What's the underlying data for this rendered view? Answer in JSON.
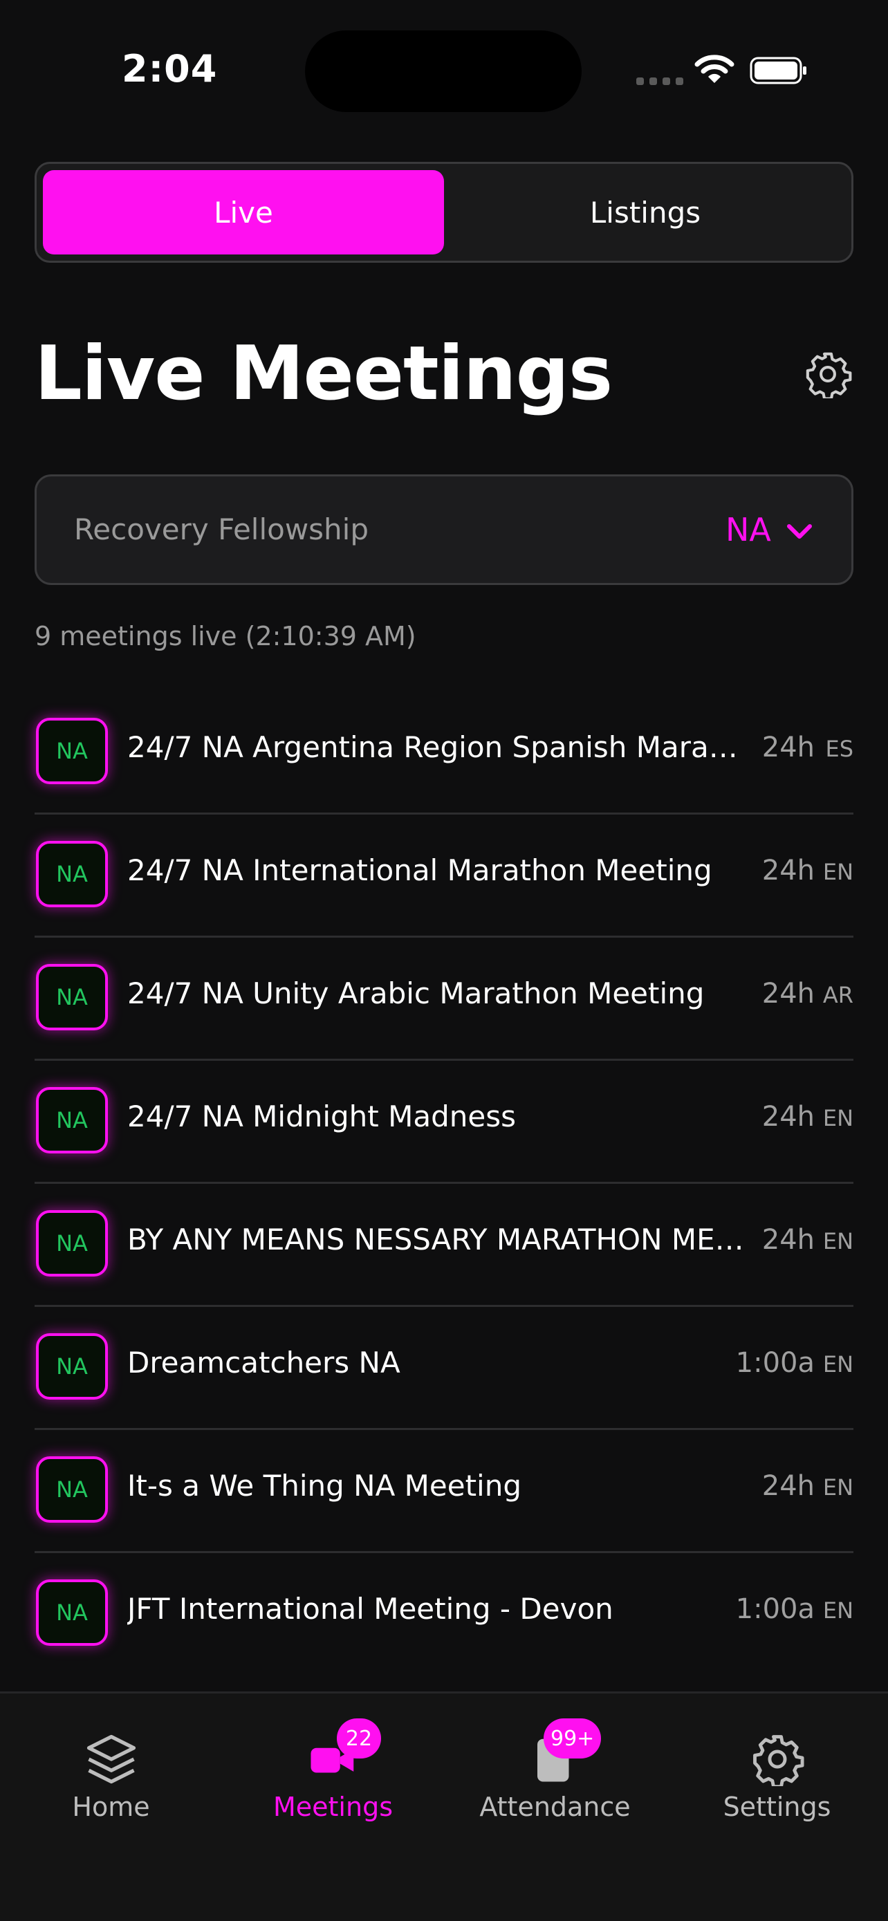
{
  "status_bar": {
    "time": "2:04"
  },
  "segmented": {
    "live_label": "Live",
    "listings_label": "Listings"
  },
  "page": {
    "title": "Live Meetings"
  },
  "fellowship": {
    "label": "Recovery Fellowship",
    "value": "NA"
  },
  "summary": {
    "text": "9 meetings live (2:10:39 AM)"
  },
  "meetings": [
    {
      "badge": "NA",
      "name": "24/7 NA Argentina Region Spanish Mara…",
      "time": "24h",
      "lang": "ES"
    },
    {
      "badge": "NA",
      "name": "24/7 NA International Marathon Meeting",
      "time": "24h",
      "lang": "EN"
    },
    {
      "badge": "NA",
      "name": "24/7 NA Unity Arabic Marathon Meeting",
      "time": "24h",
      "lang": "AR"
    },
    {
      "badge": "NA",
      "name": "24/7 NA Midnight Madness",
      "time": "24h",
      "lang": "EN"
    },
    {
      "badge": "NA",
      "name": "BY ANY MEANS NESSARY MARATHON ME…",
      "time": "24h",
      "lang": "EN"
    },
    {
      "badge": "NA",
      "name": "Dreamcatchers NA",
      "time": "1:00a",
      "lang": "EN"
    },
    {
      "badge": "NA",
      "name": "It-s a We Thing NA Meeting",
      "time": "24h",
      "lang": "EN"
    },
    {
      "badge": "NA",
      "name": "JFT International Meeting - Devon",
      "time": "1:00a",
      "lang": "EN"
    }
  ],
  "tabbar": {
    "home": {
      "label": "Home",
      "icon": "layers-icon"
    },
    "meetings": {
      "label": "Meetings",
      "icon": "video-icon",
      "badge": "22"
    },
    "attendance": {
      "label": "Attendance",
      "icon": "clipboard-icon",
      "badge": "99+"
    },
    "settings": {
      "label": "Settings",
      "icon": "gear-icon"
    }
  },
  "colors": {
    "accent": "#ff10f0",
    "badge_text": "#22c55e",
    "background": "#0e0e0f"
  }
}
